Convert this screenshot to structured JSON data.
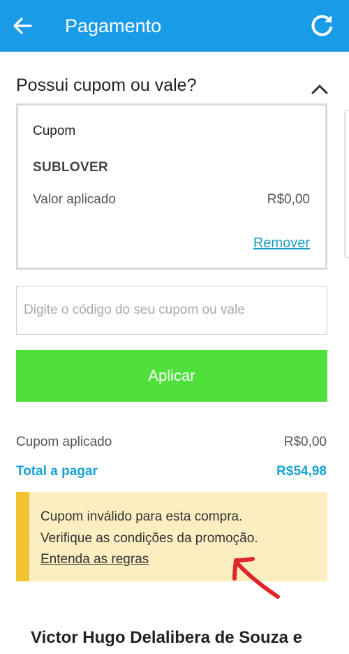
{
  "appbar": {
    "title": "Pagamento",
    "back_icon": "back-arrow-icon",
    "refresh_icon": "refresh-icon"
  },
  "section": {
    "title": "Possui cupom ou vale?",
    "collapse_icon": "chevron-up-icon"
  },
  "coupon_card": {
    "label": "Cupom",
    "code": "SUBLOVER",
    "applied_label": "Valor aplicado",
    "applied_value": "R$0,00",
    "remove_label": "Remover"
  },
  "input": {
    "placeholder": "Digite o código do seu cupom ou vale",
    "value": ""
  },
  "apply_button": {
    "label": "Aplicar"
  },
  "summary": {
    "coupon_label": "Cupom aplicado",
    "coupon_value": "R$0,00",
    "total_label": "Total a pagar",
    "total_value": "R$54,98"
  },
  "warning": {
    "line1": "Cupom inválido para esta compra.",
    "line2": "Verifique as condições da promoção.",
    "link": "Entenda as regras"
  },
  "customer_name": "Victor Hugo Delalibera de Souza e",
  "colors": {
    "appbar": "#1a9be8",
    "apply_button": "#4fe03b",
    "link": "#1a9fc7",
    "total": "#17a2d6",
    "warning_bg": "#fbefc1",
    "warning_bar": "#f1c232",
    "annotation_arrow": "#e0262b"
  }
}
